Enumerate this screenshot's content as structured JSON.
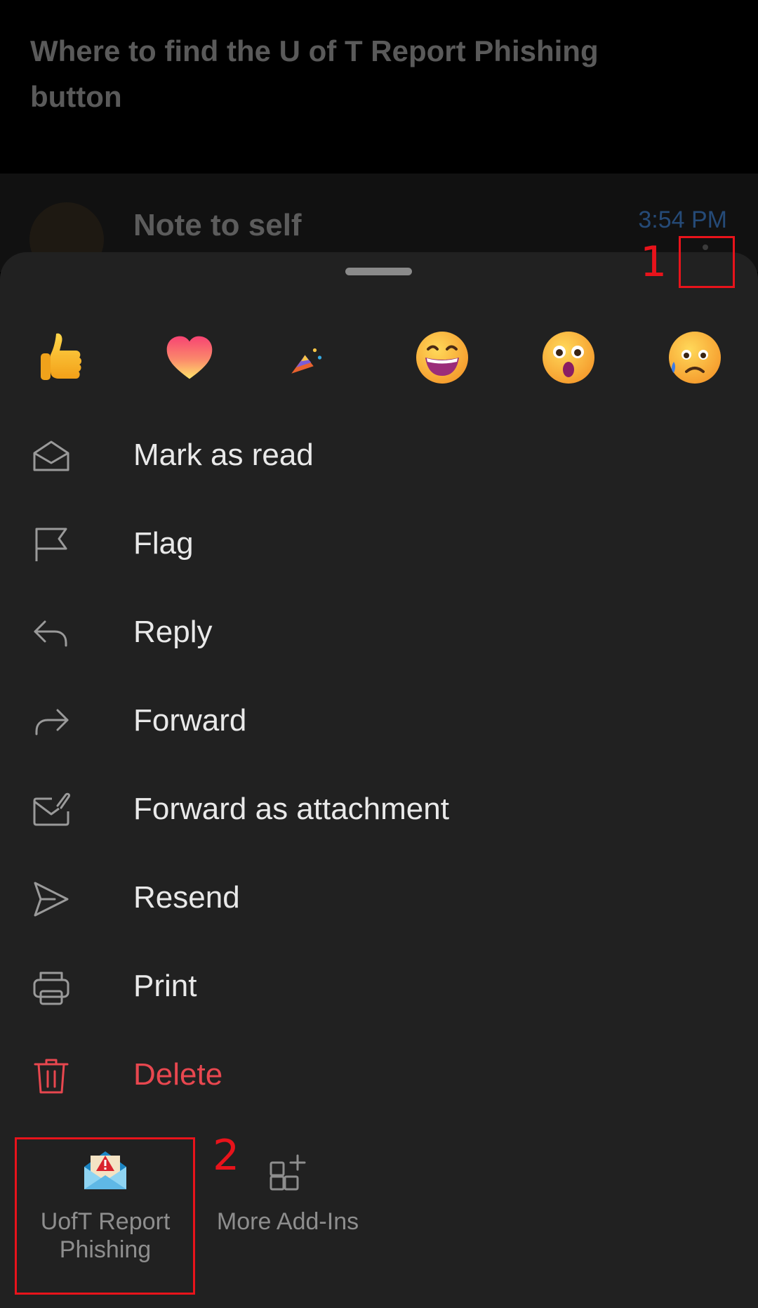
{
  "email": {
    "subject": "Where to find the U of T Report Phishing button",
    "sender": "Note to self",
    "time": "3:54 PM"
  },
  "reactions": [
    {
      "name": "thumbs-up"
    },
    {
      "name": "heart"
    },
    {
      "name": "party-popper"
    },
    {
      "name": "grinning-face"
    },
    {
      "name": "surprised-face"
    },
    {
      "name": "sad-face"
    }
  ],
  "menu": {
    "mark_as_read": "Mark as read",
    "flag": "Flag",
    "reply": "Reply",
    "forward": "Forward",
    "forward_as_attachment": "Forward as attachment",
    "resend": "Resend",
    "print": "Print",
    "delete": "Delete"
  },
  "addins": {
    "report_phishing_line1": "UofT Report",
    "report_phishing_line2": "Phishing",
    "more": "More Add-Ins"
  },
  "annotations": {
    "step1": "1",
    "step2": "2"
  },
  "colors": {
    "sheet_background": "#212121",
    "menu_text": "#e9e9e9",
    "delete_text": "#e8474f",
    "time_text": "#254a77",
    "annotation": "#e8131b"
  }
}
